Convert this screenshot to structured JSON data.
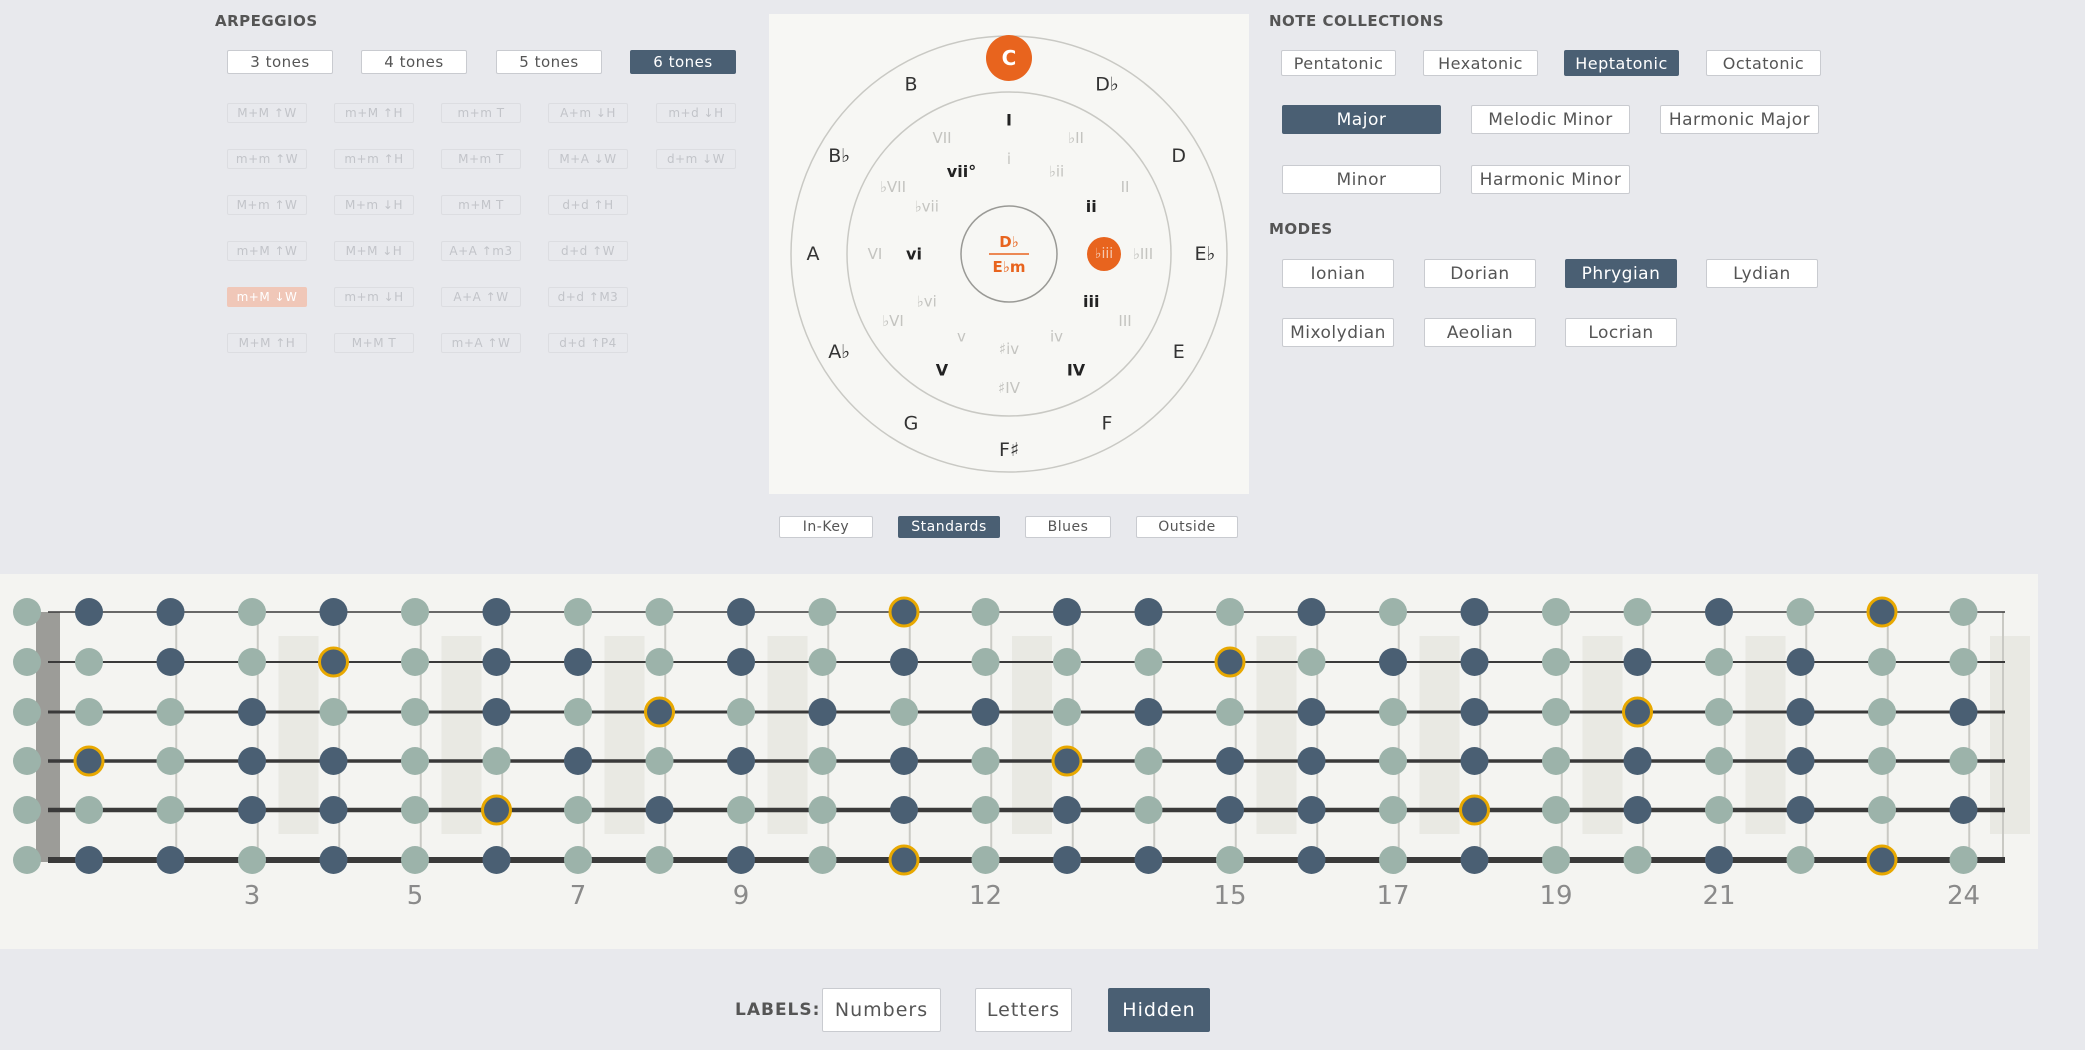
{
  "arpeggios": {
    "title": "ARPEGGIOS",
    "tones": [
      {
        "label": "3 tones",
        "selected": false
      },
      {
        "label": "4 tones",
        "selected": false
      },
      {
        "label": "5 tones",
        "selected": false
      },
      {
        "label": "6 tones",
        "selected": true
      }
    ],
    "grid": [
      [
        "M+M ↑W",
        "m+M ↑H",
        "m+m T",
        "A+m ↓H",
        "m+d ↓H"
      ],
      [
        "m+m ↑W",
        "m+m ↑H",
        "M+m T",
        "M+A ↓W",
        "d+m ↓W"
      ],
      [
        "M+m ↑W",
        "M+m ↓H",
        "m+M T",
        "d+d ↑H",
        ""
      ],
      [
        "m+M ↑W",
        "M+M ↓H",
        "A+A ↑m3",
        "d+d ↑W",
        ""
      ],
      [
        "m+M ↓W",
        "m+m ↓H",
        "A+A ↑W",
        "d+d ↑M3",
        ""
      ],
      [
        "M+M ↑H",
        "M+M T",
        "m+A ↑W",
        "d+d ↑P4",
        ""
      ]
    ],
    "highlighted": "m+M ↓W"
  },
  "circle": {
    "tonic": "C",
    "outer_keys": [
      "C",
      "D♭",
      "D",
      "E♭",
      "E",
      "F",
      "F♯",
      "G",
      "A♭",
      "A",
      "B♭",
      "B"
    ],
    "major_numerals": [
      {
        "label": "I",
        "active": true
      },
      {
        "label": "♭II",
        "active": false
      },
      {
        "label": "II",
        "active": false
      },
      {
        "label": "♭III",
        "active": false
      },
      {
        "label": "III",
        "active": false
      },
      {
        "label": "IV",
        "active": true
      },
      {
        "label": "♯IV",
        "active": false
      },
      {
        "label": "V",
        "active": true
      },
      {
        "label": "♭VI",
        "active": false
      },
      {
        "label": "VI",
        "active": false
      },
      {
        "label": "♭VII",
        "active": false
      },
      {
        "label": "VII",
        "active": false
      }
    ],
    "minor_numerals": [
      {
        "label": "i",
        "active": false
      },
      {
        "label": "♭ii",
        "active": false
      },
      {
        "label": "ii",
        "active": true
      },
      {
        "label": "♭iii",
        "active": true,
        "marked": true
      },
      {
        "label": "iii",
        "active": true
      },
      {
        "label": "iv",
        "active": false
      },
      {
        "label": "♯iv",
        "active": false
      },
      {
        "label": "v",
        "active": false
      },
      {
        "label": "♭vi",
        "active": false
      },
      {
        "label": "vi",
        "active": true
      },
      {
        "label": "♭vii",
        "active": false
      },
      {
        "label": "vii°",
        "active": true
      }
    ],
    "center_major": "D♭",
    "center_minor": "E♭m",
    "accent_color": "#e8641e"
  },
  "circle_tabs": [
    {
      "label": "In-Key",
      "selected": false
    },
    {
      "label": "Standards",
      "selected": true
    },
    {
      "label": "Blues",
      "selected": false
    },
    {
      "label": "Outside",
      "selected": false
    }
  ],
  "note_collections": {
    "title": "NOTE COLLECTIONS",
    "sizes": [
      {
        "label": "Pentatonic",
        "selected": false
      },
      {
        "label": "Hexatonic",
        "selected": false
      },
      {
        "label": "Heptatonic",
        "selected": true
      },
      {
        "label": "Octatonic",
        "selected": false
      }
    ],
    "scales": [
      {
        "label": "Major",
        "selected": true
      },
      {
        "label": "Melodic Minor",
        "selected": false
      },
      {
        "label": "Harmonic Major",
        "selected": false
      },
      {
        "label": "Minor",
        "selected": false
      },
      {
        "label": "Harmonic Minor",
        "selected": false
      }
    ]
  },
  "modes": {
    "title": "MODES",
    "items": [
      {
        "label": "Ionian",
        "selected": false
      },
      {
        "label": "Dorian",
        "selected": false
      },
      {
        "label": "Phrygian",
        "selected": true
      },
      {
        "label": "Lydian",
        "selected": false
      },
      {
        "label": "Mixolydian",
        "selected": false
      },
      {
        "label": "Aeolian",
        "selected": false
      },
      {
        "label": "Locrian",
        "selected": false
      }
    ]
  },
  "fretboard": {
    "fret_numbers": [
      "3",
      "5",
      "7",
      "9",
      "12",
      "15",
      "17",
      "19",
      "21",
      "24"
    ],
    "dot_color_dark": "#4a5f73",
    "dot_color_light": "#9cb3aa",
    "root_ring_color": "#e8a800",
    "strings": [
      "LDDLDLDLLDLRLDDLDLDLLDLRL",
      "LLDLRLDDLDLDLLLRLDDLDLDLL",
      "LLLDLLDLRLDLDLDLDLDLRLDLDL",
      "LRLDDLLDLDLDLRLDDLDLDLDLL",
      "LLLDDLRLDLLDLDLDDLRLDLDLDL",
      "LDDLDLDLLDLRLDDLDLDLLDLRL"
    ]
  },
  "labels": {
    "title": "LABELS:",
    "options": [
      {
        "label": "Numbers",
        "selected": false
      },
      {
        "label": "Letters",
        "selected": false
      },
      {
        "label": "Hidden",
        "selected": true
      }
    ]
  }
}
